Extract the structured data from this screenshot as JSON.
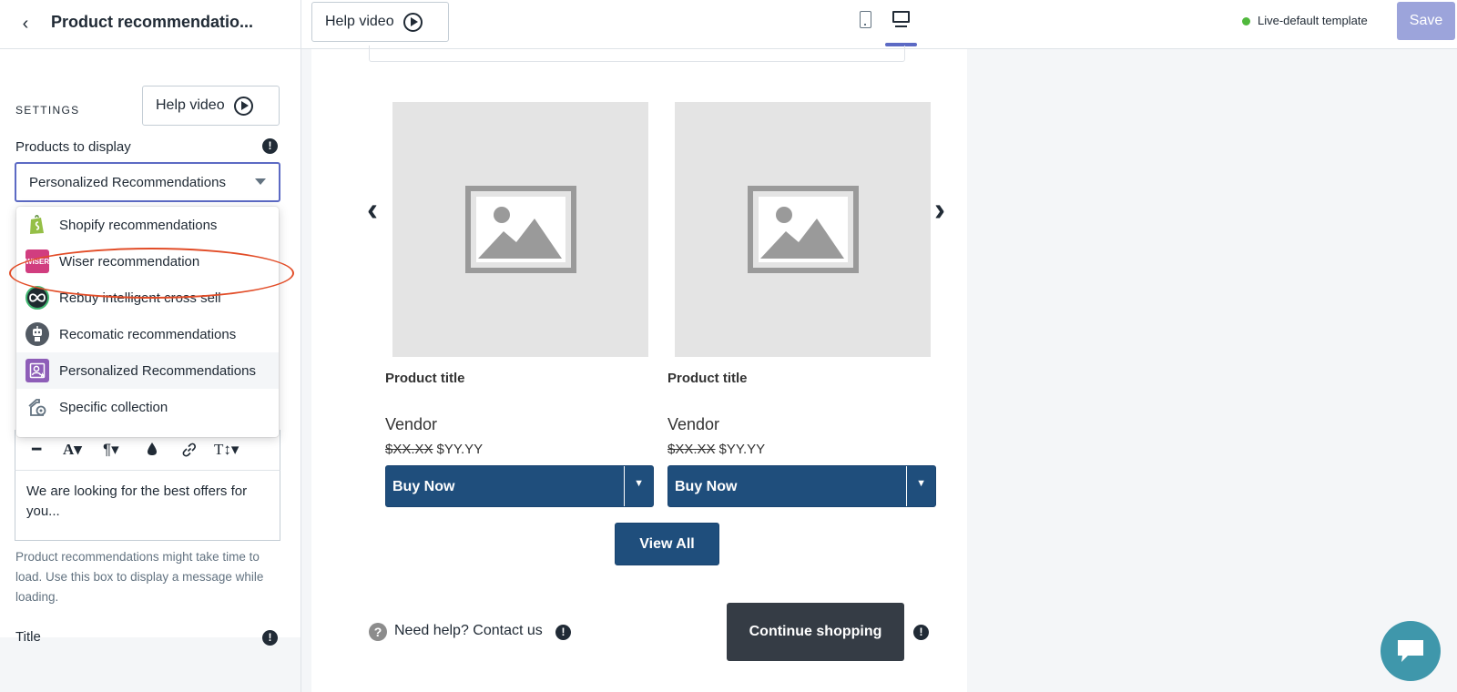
{
  "header": {
    "back_glyph": "‹",
    "title": "Product recommendatio...",
    "help_video_label": "Help video",
    "status_label": "Live-default template",
    "save_label": "Save",
    "colors": {
      "accent": "#5c6ac4",
      "save_disabled": "#9ca4db",
      "live": "#50b83c"
    }
  },
  "sidebar": {
    "settings_heading": "SETTINGS",
    "help_video_label": "Help video",
    "products_label": "Products to display",
    "selected_option": "Personalized Recommendations",
    "dropdown_options": [
      {
        "label": "Shopify recommendations",
        "icon": "shopify-icon"
      },
      {
        "label": "Wiser recommendation",
        "icon": "wiser-icon",
        "icon_text": "WISER"
      },
      {
        "label": "Rebuy intelligent cross sell",
        "icon": "rebuy-icon"
      },
      {
        "label": "Recomatic recommendations",
        "icon": "recomatic-icon"
      },
      {
        "label": "Personalized Recommendations",
        "icon": "personalized-icon"
      },
      {
        "label": "Specific collection",
        "icon": "collection-icon"
      }
    ],
    "editor_text": "We are looking for the best offers for you...",
    "help_text": "Product recommendations might take time to load. Use this box to display a message while loading.",
    "title_label": "Title"
  },
  "preview": {
    "products": [
      {
        "title": "Product title",
        "vendor": "Vendor",
        "old_price": "$XX.XX",
        "price": "$YY.YY",
        "buy_label": "Buy Now"
      },
      {
        "title": "Product title",
        "vendor": "Vendor",
        "old_price": "$XX.XX",
        "price": "$YY.YY",
        "buy_label": "Buy Now"
      }
    ],
    "view_all_label": "View All",
    "help_circle_glyph": "?",
    "need_help_label": "Need help? Contact us",
    "continue_label": "Continue shopping",
    "colors": {
      "button": "#1f4e7c",
      "continue": "#353c45",
      "chat": "#3f97ab"
    }
  }
}
